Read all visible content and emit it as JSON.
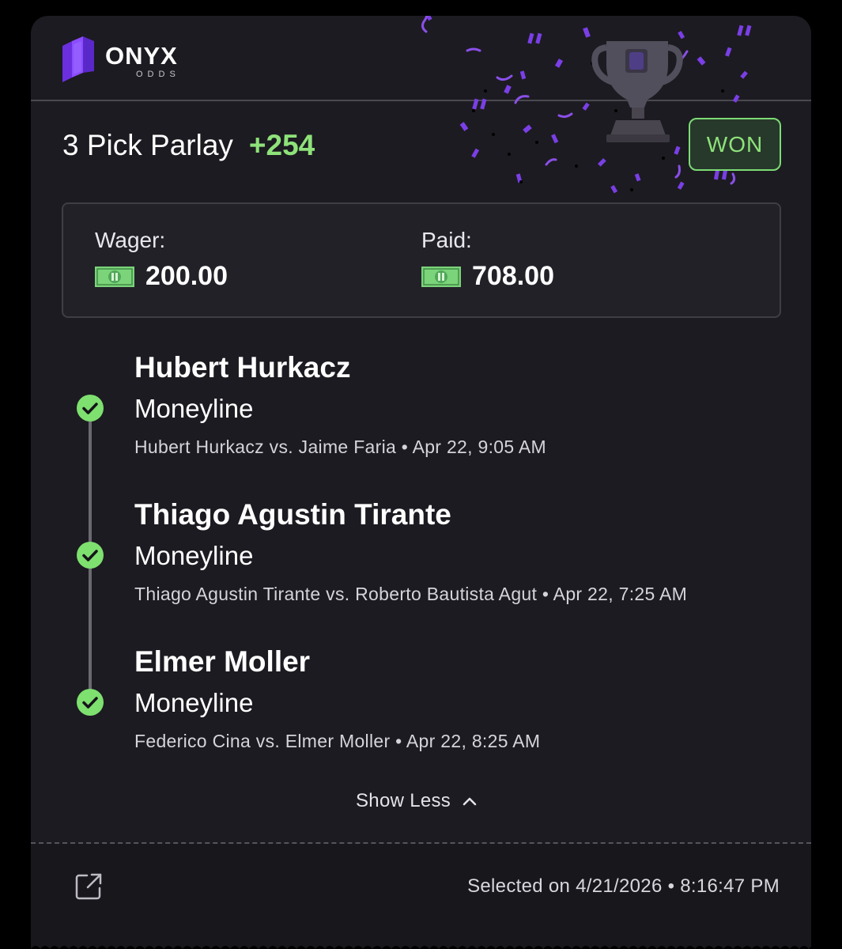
{
  "brand": {
    "name": "ONYX",
    "sub": "ODDS"
  },
  "bet": {
    "title": "3 Pick Parlay",
    "odds": "+254",
    "status": "WON"
  },
  "amounts": {
    "wager_label": "Wager:",
    "wager_value": "200.00",
    "paid_label": "Paid:",
    "paid_value": "708.00"
  },
  "picks": [
    {
      "name": "Hubert Hurkacz",
      "market": "Moneyline",
      "matchup": "Hubert Hurkacz vs. Jaime Faria",
      "time": "Apr 22, 9:05 AM",
      "result_icon": "check-circle-icon"
    },
    {
      "name": "Thiago Agustin Tirante",
      "market": "Moneyline",
      "matchup": "Thiago Agustin Tirante vs. Roberto Bautista Agut",
      "time": "Apr 22, 7:25 AM",
      "result_icon": "check-circle-icon"
    },
    {
      "name": "Elmer Moller",
      "market": "Moneyline",
      "matchup": "Federico Cina vs. Elmer Moller",
      "time": "Apr 22, 8:25 AM",
      "result_icon": "check-circle-icon"
    }
  ],
  "toggle": {
    "label": "Show Less",
    "icon": "chevron-up-icon"
  },
  "footer": {
    "selected_prefix": "Selected on",
    "date": "4/21/2026",
    "time": "8:16:47 PM",
    "share_icon": "share-external-icon"
  },
  "colors": {
    "accent_green": "#8ee27a",
    "brand_purple": "#7b3ff2",
    "card_bg": "#1c1b21"
  }
}
